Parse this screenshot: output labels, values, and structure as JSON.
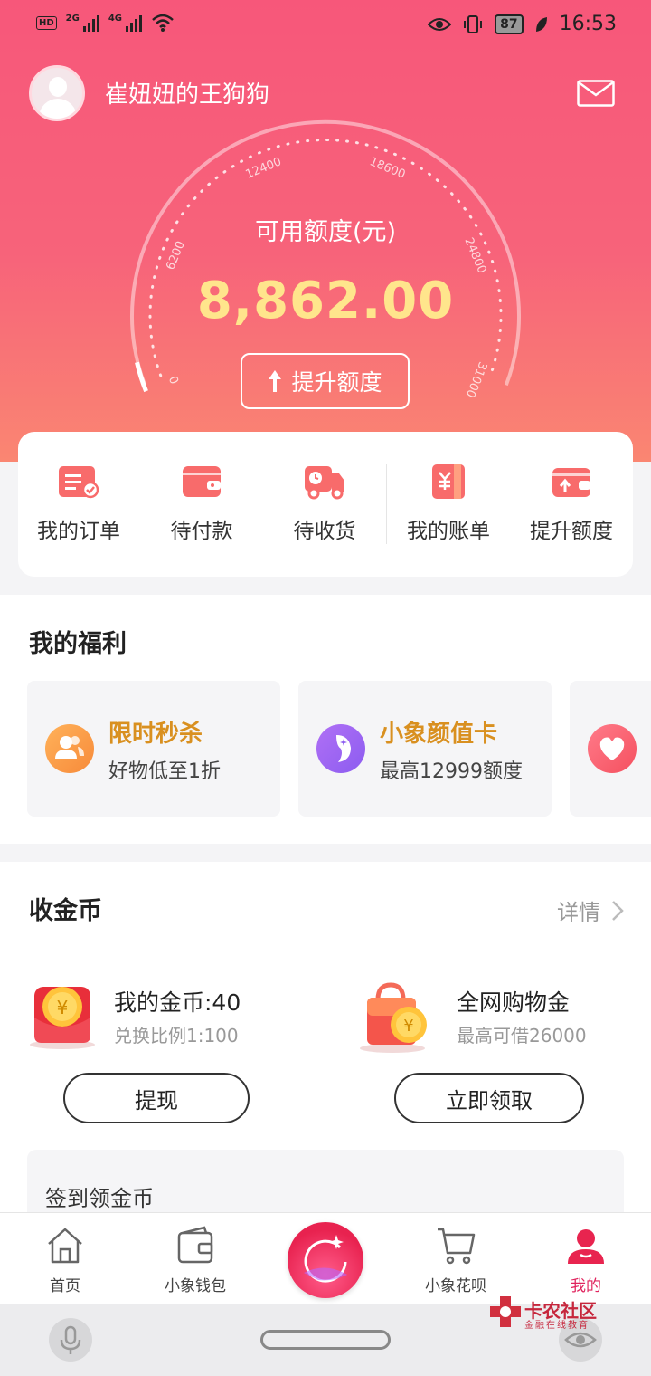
{
  "status_bar": {
    "hd_badge": "HD",
    "net1": "2G",
    "net2": "4G",
    "battery": "87",
    "time": "16:53"
  },
  "header": {
    "username": "崔妞妞的王狗狗"
  },
  "credit": {
    "label": "可用额度(元)",
    "amount": "8,862.00",
    "raise_button": "提升额度",
    "gauge_ticks": [
      "0",
      "6200",
      "12400",
      "18600",
      "24800",
      "31000"
    ],
    "gauge_level": 0.04
  },
  "quick_actions": [
    {
      "label": "我的订单",
      "icon": "order-icon"
    },
    {
      "label": "待付款",
      "icon": "wallet-icon"
    },
    {
      "label": "待收货",
      "icon": "delivery-truck-icon"
    },
    {
      "label": "我的账单",
      "icon": "bill-icon"
    },
    {
      "label": "提升额度",
      "icon": "raise-limit-icon"
    }
  ],
  "welfare": {
    "title": "我的福利",
    "cards": [
      {
        "title": "限时秒杀",
        "subtitle": "好物低至1折",
        "icon": "users-icon"
      },
      {
        "title": "小象颜值卡",
        "subtitle": "最高12999额度",
        "icon": "face-icon"
      }
    ]
  },
  "coins": {
    "title": "收金币",
    "detail": "详情",
    "my_coins": {
      "title": "我的金币:40",
      "subtitle": "兑换比例1:100",
      "button": "提现"
    },
    "shopping": {
      "title": "全网购物金",
      "subtitle": "最高可借26000",
      "button": "立即领取"
    },
    "signin_title": "签到领金币"
  },
  "tabs": [
    {
      "label": "首页",
      "icon": "home-icon"
    },
    {
      "label": "小象钱包",
      "icon": "wallet-icon"
    },
    {
      "label": "",
      "icon": "center-logo-icon"
    },
    {
      "label": "小象花呗",
      "icon": "cart-icon"
    },
    {
      "label": "我的",
      "icon": "profile-icon",
      "active": true
    }
  ],
  "watermark": {
    "title": "卡农社区",
    "subtitle": "金融在线教育"
  },
  "colors": {
    "hero_top": "#f7577a",
    "hero_bottom": "#fa8672",
    "amount": "#ffe58c",
    "welfare_title": "#d99020",
    "active_tab": "#e0245e"
  }
}
